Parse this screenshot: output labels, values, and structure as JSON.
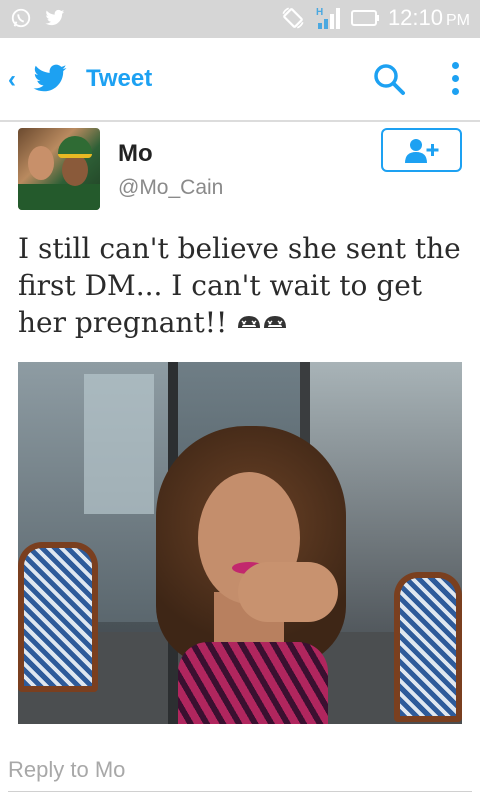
{
  "status_bar": {
    "time": "12:10",
    "ampm": "PM",
    "network": "H",
    "icons": [
      "whatsapp-icon",
      "twitter-icon",
      "rotate-icon",
      "signal-icon",
      "battery-icon"
    ]
  },
  "app_bar": {
    "title": "Tweet",
    "icons": [
      "back-chevron-icon",
      "twitter-bird-icon",
      "search-icon",
      "overflow-menu-icon"
    ],
    "accent": "#1da1f2"
  },
  "tweet": {
    "author_name": "Mo",
    "author_handle": "@Mo_Cain",
    "text": "I still can't believe she sent the first DM... I can't wait to get her pregnant!!",
    "emoji": [
      "grinning-face-icon",
      "grinning-face-icon"
    ]
  },
  "reply": {
    "placeholder": "Reply to Mo"
  }
}
